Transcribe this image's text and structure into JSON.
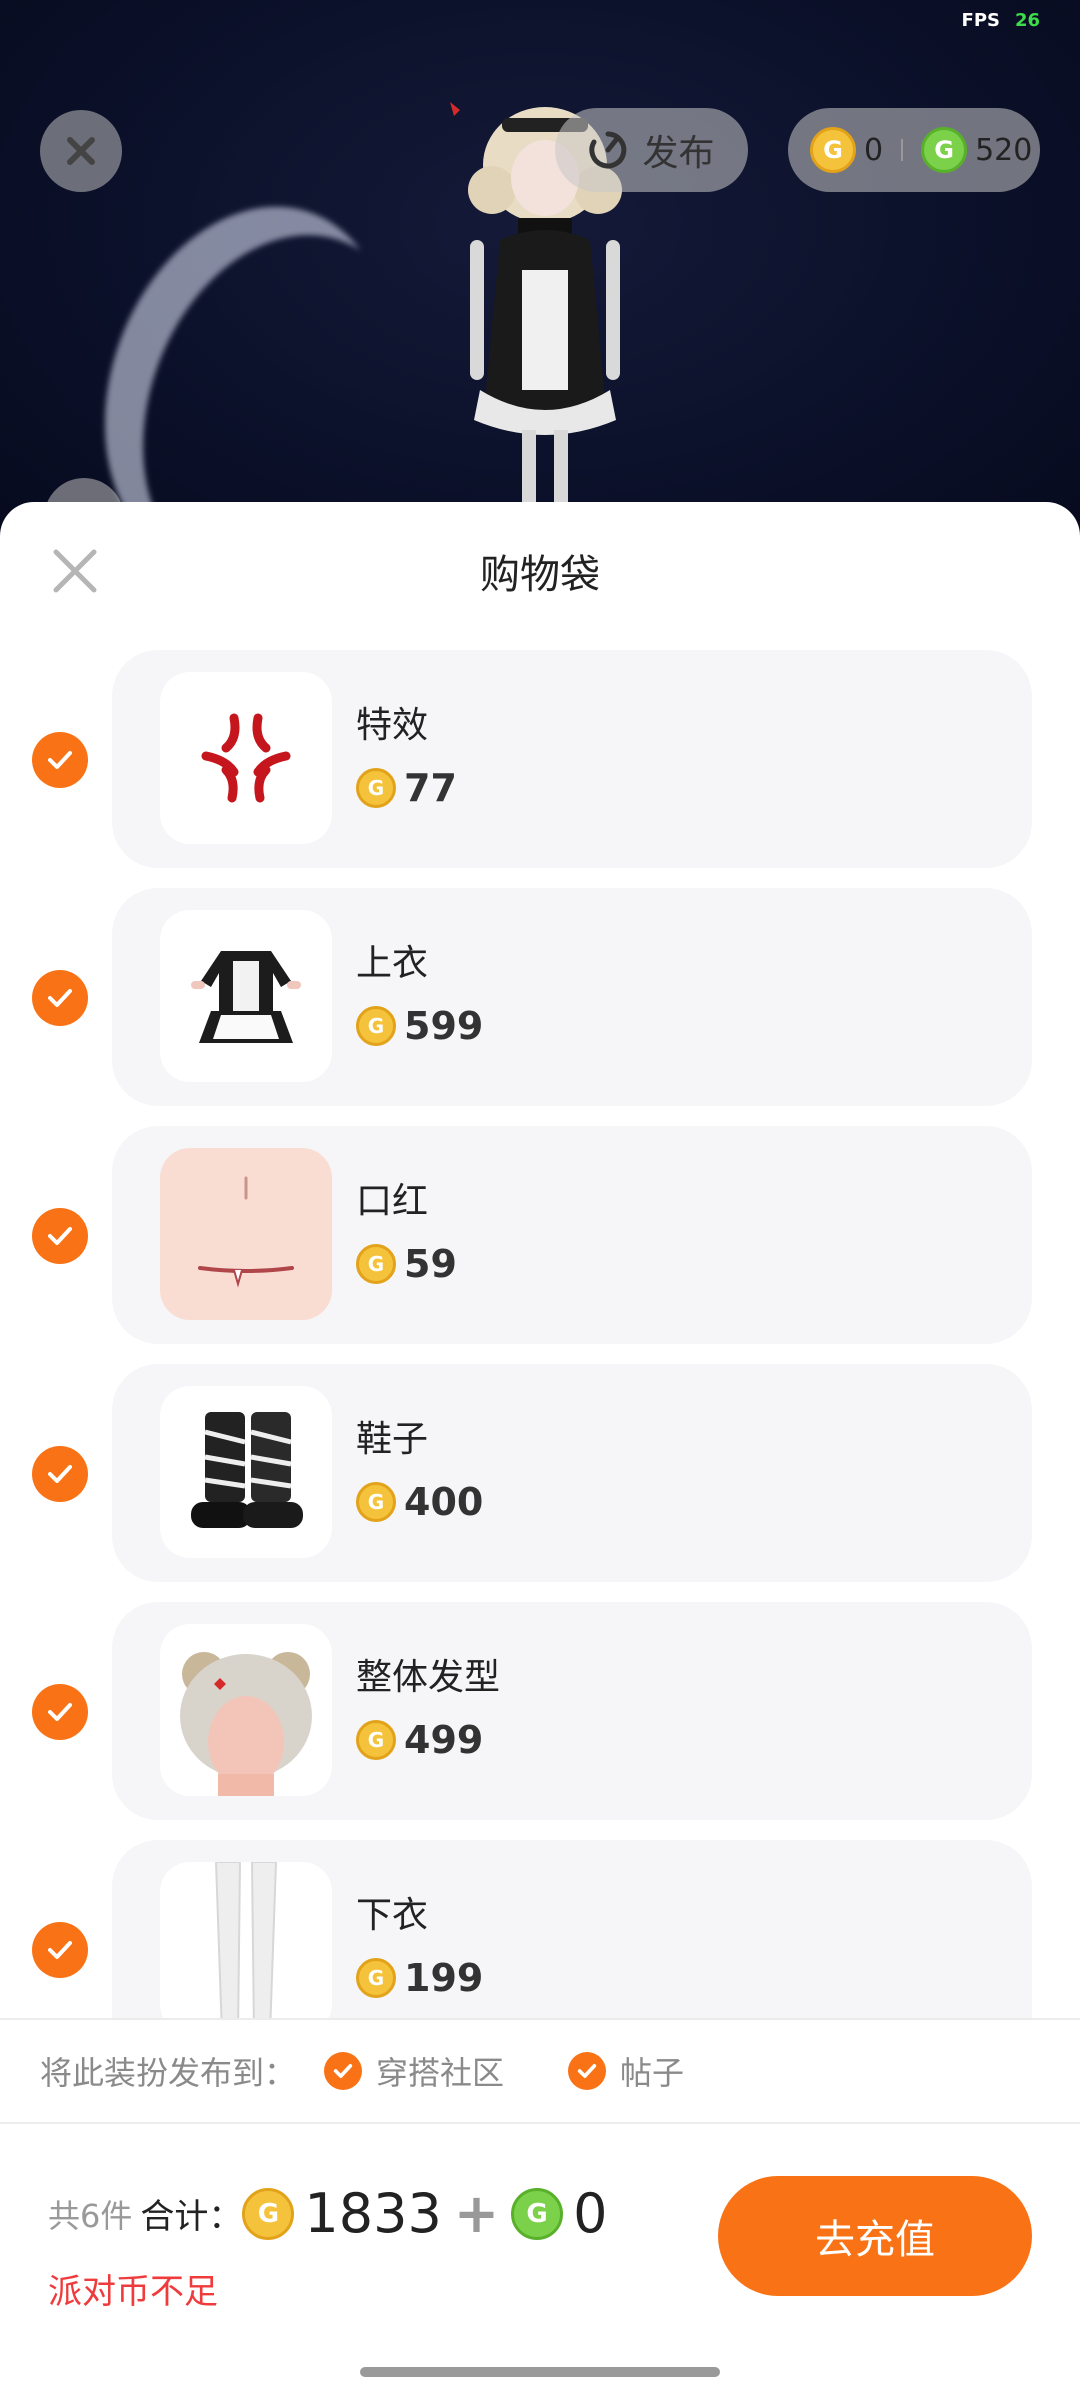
{
  "hud": {
    "fps_label": "FPS",
    "fps_value": "26"
  },
  "top_bar": {
    "publish_label": "发布",
    "gold_balance": "0",
    "green_balance": "520"
  },
  "sheet": {
    "title": "购物袋"
  },
  "items": [
    {
      "name": "特效",
      "price": "77",
      "thumb": "anger-mark-effect",
      "checked": true
    },
    {
      "name": "上衣",
      "price": "599",
      "thumb": "maid-dress",
      "checked": true
    },
    {
      "name": "口红",
      "price": "59",
      "thumb": "lips-fang",
      "checked": true
    },
    {
      "name": "鞋子",
      "price": "400",
      "thumb": "platform-boots",
      "checked": true
    },
    {
      "name": "整体发型",
      "price": "499",
      "thumb": "hairstyle-buns",
      "checked": true
    },
    {
      "name": "下衣",
      "price": "199",
      "thumb": "white-stockings",
      "checked": true
    }
  ],
  "publish_to": {
    "label": "将此装扮发布到：",
    "options": [
      {
        "label": "穿搭社区",
        "checked": true
      },
      {
        "label": "帖子",
        "checked": true
      }
    ]
  },
  "footer": {
    "count_text": "共6件",
    "total_label": "合计：",
    "gold_total": "1833",
    "plus": "+",
    "green_total": "0",
    "warning": "派对币不足",
    "recharge_label": "去充值"
  },
  "colors": {
    "accent": "#f97316",
    "warning": "#ef3b3b",
    "gold_coin": "#f5c33b",
    "green_coin": "#7bd24a"
  }
}
